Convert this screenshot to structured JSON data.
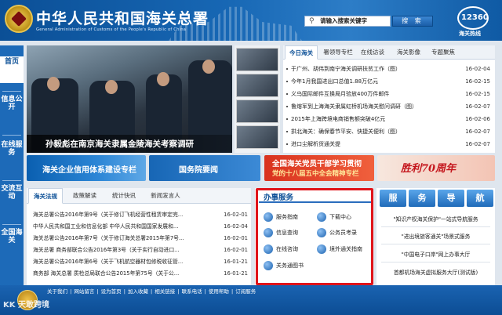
{
  "header": {
    "title": "中华人民共和国海关总署",
    "subtitle": "General Administration of Customs of the People's Republic of China",
    "search_placeholder": "请输入搜索关键字",
    "search_button": "搜 索",
    "hotline_number": "12360",
    "hotline_label": "海关热线"
  },
  "sidenav": [
    "首页",
    "信息公开",
    "在线服务",
    "交流互动",
    "全国海关"
  ],
  "slideshow": {
    "caption": "孙毅彪在南京海关隶属金陵海关考察调研"
  },
  "news": {
    "tabs": [
      "今日海关",
      "署领导专栏",
      "在线访谈",
      "海关影像",
      "专题聚焦"
    ],
    "items": [
      {
        "title": "于广州、胡伟到南宁海关调研扶贫工作（图）",
        "date": "16-02-04"
      },
      {
        "title": "今年1月我国进出口总值1.88万亿元",
        "date": "16-02-15"
      },
      {
        "title": "义乌国际邮件互换局月验放400万件邮件",
        "date": "16-02-15"
      },
      {
        "title": "鲁熔军到上海海关隶属虹桥机场海关慰问调研（图）",
        "date": "16-02-07"
      },
      {
        "title": "2015年上海跨境电商销售额突破4亿元",
        "date": "16-02-06"
      },
      {
        "title": "拱北海关：确保春节平安、快捷关便利（图）",
        "date": "16-02-07"
      },
      {
        "title": "进口尘解析货通关提",
        "date": "16-02-07"
      }
    ]
  },
  "banners": {
    "b1": "海关企业信用体系建设专栏",
    "b2": "国务院要闻",
    "b3_line1": "全国海关党员干部学习贯彻",
    "b3_line2": "党的十八届五中全会精神专栏",
    "b4": "胜利70周年"
  },
  "notices": {
    "tabs": [
      "海关法规",
      "政策解读",
      "统计快讯",
      "新闻发言人"
    ],
    "items": [
      {
        "title": "海关总署公告2016年第9号（关于修订飞机经营性租赁审定完...",
        "date": "16-02-01"
      },
      {
        "title": "中华人民共和国工业和信息化部 中华人民共和国国家发展和...",
        "date": "16-02-04"
      },
      {
        "title": "海关总署公告2016年第7号（关于修订海关总署2015年第7号...",
        "date": "16-02-01"
      },
      {
        "title": "海关总署 商务部联合公告2016年第3号（关于实行自动进口...",
        "date": "16-02-01"
      },
      {
        "title": "海关总署公告2016年第6号（关于飞机航空器材包修税收征管...",
        "date": "16-01-21"
      },
      {
        "title": "商务部 海关总署 质检总局联合公告2015年第75号（关于公...",
        "date": "16-01-21"
      }
    ]
  },
  "online_service": {
    "title": "办事服务",
    "buttons": [
      "服务指南",
      "下载中心",
      "信息查询",
      "公务员考录",
      "在线咨询",
      "境外通关指南",
      "关务通图书"
    ]
  },
  "service_nav": {
    "blocks": [
      "服",
      "务",
      "导",
      "航"
    ],
    "items": [
      "\"知识产权海关保护\"一站式导航服务",
      "\"进出境旅客通关\"场景式服务",
      "\"中国电子口岸\"网上办事大厅",
      "首都机场海关虚拟服务大厅(测试版)"
    ]
  },
  "footer": {
    "links": "关于我们 | 网站留言 | 设为首页 | 加入收藏 | 相关链接 | 联系电话 | 使用帮助 | 订阅服务",
    "watermark": "KK 天敢跨境"
  }
}
